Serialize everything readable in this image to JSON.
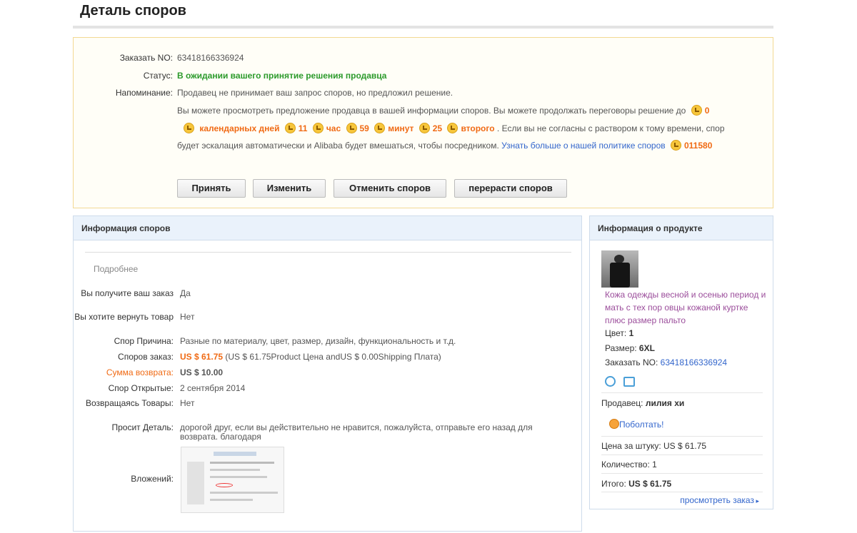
{
  "page_title": "Деталь споров",
  "status": {
    "order_label": "Заказать NO:",
    "order_no": "63418166336924",
    "status_label": "Статус:",
    "status_value": "В ожидании вашего принятие решения продавца",
    "reminder_label": "Напоминание:",
    "reminder_line1": "Продавец не принимает ваш запрос споров, но предложил решение.",
    "reminder_line2": "Вы можете просмотреть предложение продавца в вашей информации споров. Вы можете продолжать переговоры решение до",
    "countdown_days": "0",
    "days_label": "календарных дней",
    "countdown_hours": "11",
    "hours_label": "час",
    "countdown_minutes": "59",
    "minutes_label": "минут",
    "countdown_seconds": "25",
    "seconds_label": "второго",
    "reminder_line3_tail": ". Если вы не согласны с раствором к тому времени, спор",
    "reminder_line4": "будет эскалация автоматически и Alibaba будет вмешаться, чтобы посредником.",
    "policy_link": "Узнать больше о нашей политике споров",
    "policy_code": "011580"
  },
  "buttons": {
    "accept": "Принять",
    "modify": "Изменить",
    "cancel": "Отменить споров",
    "escalate": "перерасти споров"
  },
  "dispute_info": {
    "header": "Информация споров",
    "section": "Подробнее",
    "rows": [
      {
        "label": "Вы получите ваш заказ",
        "value": "Да"
      },
      {
        "label": "Вы хотите вернуть товар",
        "value": "Нет"
      },
      {
        "label": "Спор Причина:",
        "value": "Разные по материалу, цвет, размер, дизайн, функциональность и т.д."
      },
      {
        "label": "Споров заказ:",
        "value_bold": "US $ 61.75",
        "value": " (US $ 61.75Product Цена andUS $ 0.00Shipping Плата)"
      },
      {
        "label": "Сумма возврата:",
        "value": "US $ 10.00"
      },
      {
        "label": "Спор Открытые:",
        "value": "2 сентября 2014"
      },
      {
        "label": "Возвращаясь Товары:",
        "value": "Нет"
      },
      {
        "label": "Просит Деталь:",
        "value": "дорогой друг, если вы действительно не нравится, пожалуйста, отправьте его назад для возврата. благодаря"
      },
      {
        "label": "Вложений:"
      }
    ]
  },
  "product_info": {
    "header": "Информация о продукте",
    "title": "Кожа одежды весной и осенью период и мать с тех пор овцы кожаной куртке плюс размер пальто",
    "color_label": "Цвет:",
    "color_value": "1",
    "size_label": "Размер:",
    "size_value": "6XL",
    "order_label": "Заказать NO:",
    "order_no": "63418166336924",
    "seller_label": "Продавец:",
    "seller_name": "лилия хи",
    "chat": "Поболтать!",
    "unit_price_label": "Цена за штуку:",
    "unit_price": "US $ 61.75",
    "qty_label": "Количество:",
    "qty": "1",
    "total_label": "Итого:",
    "total": "US $ 61.75",
    "view_order": "просмотреть заказ"
  },
  "colors": {
    "accent_link": "#3366cc",
    "orange": "#f06a14",
    "green": "#2b9a2b",
    "product_link": "#9b4d9b"
  }
}
